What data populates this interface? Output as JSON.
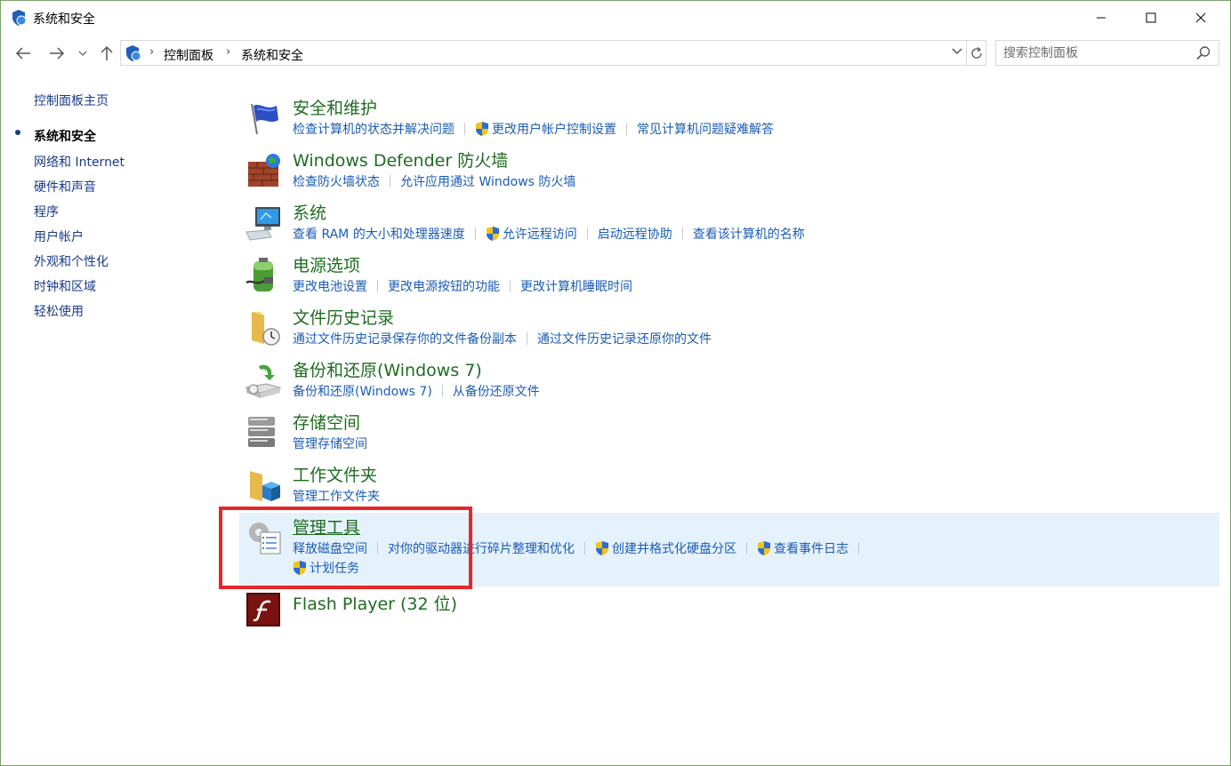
{
  "window": {
    "title": "系统和安全"
  },
  "address": {
    "crumbs": [
      "控制面板",
      "系统和安全"
    ]
  },
  "search": {
    "placeholder": "搜索控制面板"
  },
  "leftnav": {
    "items": [
      "控制面板主页",
      "系统和安全",
      "网络和 Internet",
      "硬件和声音",
      "程序",
      "用户帐户",
      "外观和个性化",
      "时钟和区域",
      "轻松使用"
    ]
  },
  "categories": [
    {
      "title": "安全和维护",
      "icon": "security-flag-icon",
      "links": [
        {
          "t": "检查计算机的状态并解决问题"
        },
        {
          "t": "更改用户帐户控制设置",
          "shield": true
        },
        {
          "t": "常见计算机问题疑难解答"
        }
      ]
    },
    {
      "title": "Windows Defender 防火墙",
      "icon": "firewall-icon",
      "links": [
        {
          "t": "检查防火墙状态"
        },
        {
          "t": "允许应用通过 Windows 防火墙"
        }
      ]
    },
    {
      "title": "系统",
      "icon": "computer-icon",
      "links": [
        {
          "t": "查看 RAM 的大小和处理器速度"
        },
        {
          "t": "允许远程访问",
          "shield": true
        },
        {
          "t": "启动远程协助"
        },
        {
          "t": "查看该计算机的名称"
        }
      ]
    },
    {
      "title": "电源选项",
      "icon": "battery-icon",
      "links": [
        {
          "t": "更改电池设置"
        },
        {
          "t": "更改电源按钮的功能"
        },
        {
          "t": "更改计算机睡眠时间"
        }
      ]
    },
    {
      "title": "文件历史记录",
      "icon": "file-history-icon",
      "links": [
        {
          "t": "通过文件历史记录保存你的文件备份副本"
        },
        {
          "t": "通过文件历史记录还原你的文件"
        }
      ]
    },
    {
      "title": "备份和还原(Windows 7)",
      "icon": "backup-icon",
      "links": [
        {
          "t": "备份和还原(Windows 7)"
        },
        {
          "t": "从备份还原文件"
        }
      ]
    },
    {
      "title": "存储空间",
      "icon": "storage-icon",
      "links": [
        {
          "t": "管理存储空间"
        }
      ]
    },
    {
      "title": "工作文件夹",
      "icon": "work-folders-icon",
      "links": [
        {
          "t": "管理工作文件夹"
        }
      ]
    },
    {
      "title": "管理工具",
      "icon": "admin-tools-icon",
      "links": [
        {
          "t": "释放磁盘空间"
        },
        {
          "t": "对你的驱动器进行碎片整理和优化"
        },
        {
          "t": "创建并格式化硬盘分区",
          "shield": true
        },
        {
          "t": "查看事件日志",
          "shield": true
        }
      ],
      "links2": [
        {
          "t": "计划任务",
          "shield": true
        }
      ]
    },
    {
      "title": "Flash Player (32 位)",
      "icon": "flash-icon",
      "links": []
    }
  ],
  "colors": {
    "title_green": "#1e6c20",
    "link_blue": "#1a5cb5",
    "highlight_bg": "#e5f1fb",
    "annotation_red": "#e8262a"
  }
}
